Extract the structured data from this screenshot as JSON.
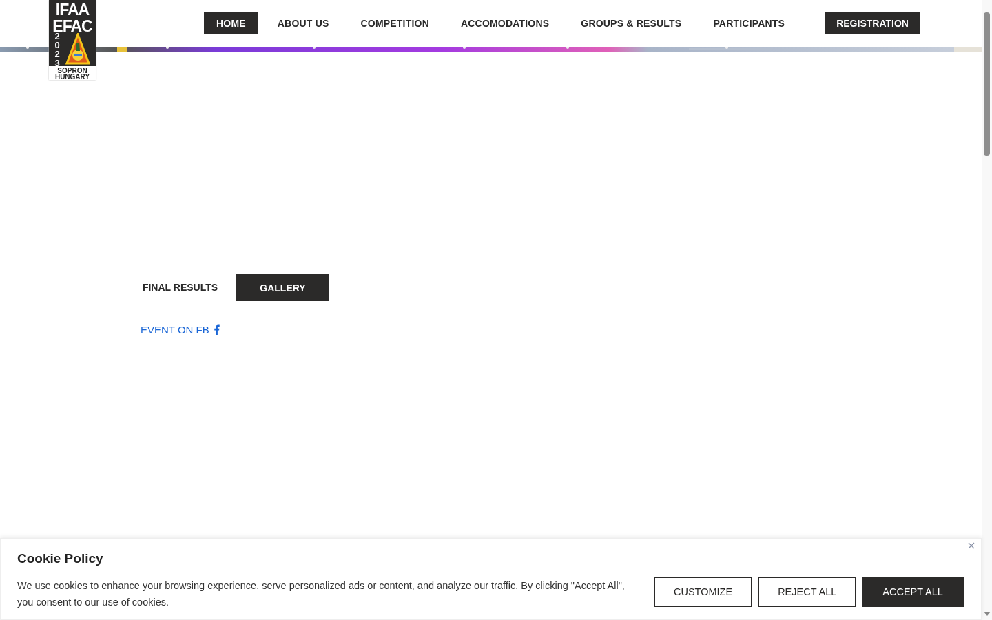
{
  "logo": {
    "line_1": "IFAA",
    "line_2": "EFAC",
    "year": "2023",
    "place_1": "SOPRON",
    "place_2": "HUNGARY"
  },
  "nav": [
    {
      "label": "HOME",
      "selected": true
    },
    {
      "label": "ABOUT US",
      "selected": false
    },
    {
      "label": "COMPETITION",
      "selected": false
    },
    {
      "label": "ACCOMODATIONS",
      "selected": false
    },
    {
      "label": "GROUPS & RESULTS",
      "selected": false
    },
    {
      "label": "PARTICIPANTS",
      "selected": false
    }
  ],
  "registration": "REGISTRATION",
  "actions": [
    {
      "label": "FINAL RESULTS",
      "kind": "plain"
    },
    {
      "label": "GALLERY",
      "kind": "dark"
    }
  ],
  "fb_link": "EVENT ON FB",
  "cookie": {
    "title": "Cookie Policy",
    "text": "We use cookies to enhance your browsing experience, serve personalized ads or content, and analyze our traffic. By clicking \"Accept All\", you consent to our use of cookies.",
    "buttons": [
      {
        "label": "CUSTOMIZE",
        "kind": "outline"
      },
      {
        "label": "REJECT ALL",
        "kind": "outline"
      },
      {
        "label": "ACCEPT ALL",
        "kind": "dark"
      }
    ]
  }
}
